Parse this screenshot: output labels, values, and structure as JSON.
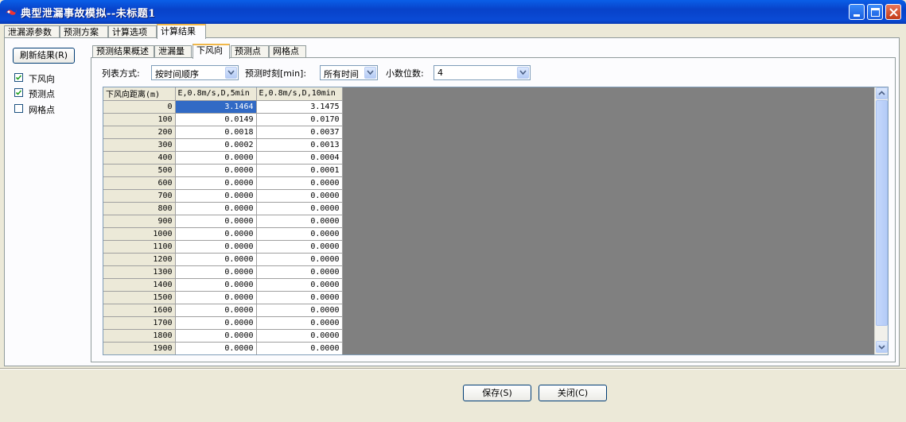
{
  "window": {
    "title": "典型泄漏事故模拟--未标题1"
  },
  "outer_tabs": [
    {
      "label": "泄漏源参数"
    },
    {
      "label": "预测方案"
    },
    {
      "label": "计算选项"
    },
    {
      "label": "计算结果"
    }
  ],
  "left_panel": {
    "refresh_label": "刷新结果(R)",
    "checkboxes": [
      {
        "label": "下风向",
        "checked": true
      },
      {
        "label": "预测点",
        "checked": true
      },
      {
        "label": "网格点",
        "checked": false
      }
    ]
  },
  "inner_tabs": [
    {
      "label": "预测结果概述"
    },
    {
      "label": "泄漏量"
    },
    {
      "label": "下风向"
    },
    {
      "label": "预测点"
    },
    {
      "label": "网格点"
    }
  ],
  "options": {
    "list_mode_label": "列表方式:",
    "list_mode_value": "按时间顺序",
    "time_label": "预测时刻[min]:",
    "time_value": "所有时间",
    "decimals_label": "小数位数:",
    "decimals_value": "4"
  },
  "table": {
    "headers": [
      "下风向距离(m)",
      "E,0.8m/s,D,5min",
      "E,0.8m/s,D,10min"
    ],
    "rows": [
      [
        "0",
        "3.1464",
        "3.1475"
      ],
      [
        "100",
        "0.0149",
        "0.0170"
      ],
      [
        "200",
        "0.0018",
        "0.0037"
      ],
      [
        "300",
        "0.0002",
        "0.0013"
      ],
      [
        "400",
        "0.0000",
        "0.0004"
      ],
      [
        "500",
        "0.0000",
        "0.0001"
      ],
      [
        "600",
        "0.0000",
        "0.0000"
      ],
      [
        "700",
        "0.0000",
        "0.0000"
      ],
      [
        "800",
        "0.0000",
        "0.0000"
      ],
      [
        "900",
        "0.0000",
        "0.0000"
      ],
      [
        "1000",
        "0.0000",
        "0.0000"
      ],
      [
        "1100",
        "0.0000",
        "0.0000"
      ],
      [
        "1200",
        "0.0000",
        "0.0000"
      ],
      [
        "1300",
        "0.0000",
        "0.0000"
      ],
      [
        "1400",
        "0.0000",
        "0.0000"
      ],
      [
        "1500",
        "0.0000",
        "0.0000"
      ],
      [
        "1600",
        "0.0000",
        "0.0000"
      ],
      [
        "1700",
        "0.0000",
        "0.0000"
      ],
      [
        "1800",
        "0.0000",
        "0.0000"
      ],
      [
        "1900",
        "0.0000",
        "0.0000"
      ]
    ]
  },
  "buttons": {
    "save": "保存(S)",
    "close": "关闭(C)"
  },
  "colors": {
    "titlebar": "#0842c9",
    "selection": "#316ac5",
    "tab_highlight": "#f1b84a",
    "grid_background": "#808080"
  },
  "icons": {
    "app": "app-icon",
    "minimize": "minimize-icon",
    "maximize": "maximize-icon",
    "close": "close-icon",
    "checkmark": "checkmark-icon",
    "dropdown": "chevron-down-icon"
  }
}
